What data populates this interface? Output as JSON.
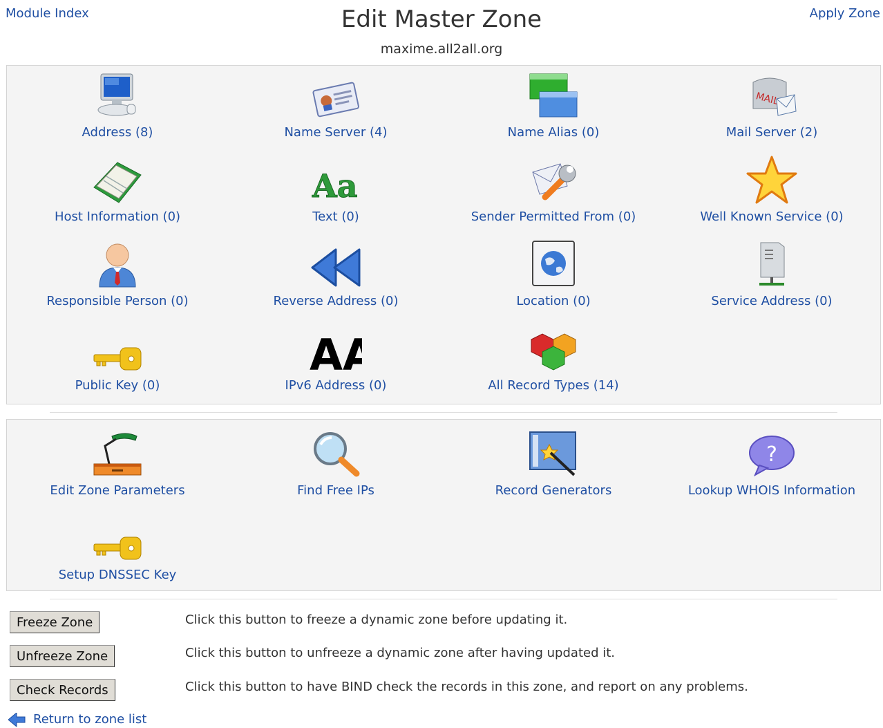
{
  "header": {
    "module_index": "Module Index",
    "apply_zone": "Apply Zone",
    "title": "Edit Master Zone",
    "zone_name": "maxime.all2all.org"
  },
  "record_types": [
    {
      "label": "Address (8)",
      "icon": "computer-icon"
    },
    {
      "label": "Name Server (4)",
      "icon": "id-card-icon"
    },
    {
      "label": "Name Alias (0)",
      "icon": "windows-icon"
    },
    {
      "label": "Mail Server (2)",
      "icon": "mailbox-icon"
    },
    {
      "label": "Host Information (0)",
      "icon": "book-icon"
    },
    {
      "label": "Text (0)",
      "icon": "font-icon"
    },
    {
      "label": "Sender Permitted From (0)",
      "icon": "mail-wrench-icon"
    },
    {
      "label": "Well Known Service (0)",
      "icon": "star-icon"
    },
    {
      "label": "Responsible Person (0)",
      "icon": "person-icon"
    },
    {
      "label": "Reverse Address (0)",
      "icon": "rewind-icon"
    },
    {
      "label": "Location (0)",
      "icon": "globe-icon"
    },
    {
      "label": "Service Address (0)",
      "icon": "server-icon"
    },
    {
      "label": "Public Key (0)",
      "icon": "key-icon"
    },
    {
      "label": "IPv6 Address (0)",
      "icon": "aaaa-icon"
    },
    {
      "label": "All Record Types (14)",
      "icon": "cubes-icon"
    }
  ],
  "tools": [
    {
      "label": "Edit Zone Parameters",
      "icon": "desk-lamp-icon"
    },
    {
      "label": "Find Free IPs",
      "icon": "magnifier-icon"
    },
    {
      "label": "Record Generators",
      "icon": "wand-icon"
    },
    {
      "label": "Lookup WHOIS Information",
      "icon": "question-bubble-icon"
    },
    {
      "label": "Setup DNSSEC Key",
      "icon": "key-icon"
    }
  ],
  "actions": [
    {
      "button": "Freeze Zone",
      "description": "Click this button to freeze a dynamic zone before updating it."
    },
    {
      "button": "Unfreeze Zone",
      "description": "Click this button to unfreeze a dynamic zone after having updated it."
    },
    {
      "button": "Check Records",
      "description": "Click this button to have BIND check the records in this zone, and report on any problems."
    }
  ],
  "footer": {
    "return_link": "Return to zone list",
    "icon": "back-arrow-icon"
  }
}
